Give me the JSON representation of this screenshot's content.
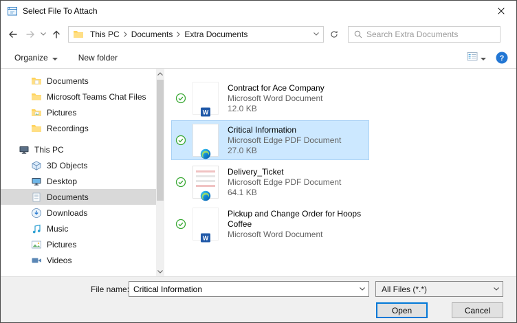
{
  "window": {
    "title": "Select File To Attach"
  },
  "navbar": {
    "breadcrumb": {
      "segments": [
        "This PC",
        "Documents",
        "Extra Documents"
      ]
    },
    "search_placeholder": "Search Extra Documents"
  },
  "toolbar": {
    "organize": "Organize",
    "new_folder": "New folder"
  },
  "sidebar": {
    "items": [
      {
        "label": "Documents"
      },
      {
        "label": "Microsoft Teams Chat Files"
      },
      {
        "label": "Pictures"
      },
      {
        "label": "Recordings"
      },
      {
        "label": "This PC"
      },
      {
        "label": "3D Objects"
      },
      {
        "label": "Desktop"
      },
      {
        "label": "Documents"
      },
      {
        "label": "Downloads"
      },
      {
        "label": "Music"
      },
      {
        "label": "Pictures"
      },
      {
        "label": "Videos"
      }
    ]
  },
  "files": [
    {
      "name": "Contract for Ace Company",
      "type": "Microsoft Word Document",
      "size": "12.0 KB"
    },
    {
      "name": "Critical Information",
      "type": "Microsoft Edge PDF Document",
      "size": "27.0 KB"
    },
    {
      "name": "Delivery_Ticket",
      "type": "Microsoft Edge PDF Document",
      "size": "64.1 KB"
    },
    {
      "name": "Pickup and Change Order for Hoops Coffee",
      "type": "Microsoft Word Document",
      "size": ""
    }
  ],
  "footer": {
    "file_name_label": "File name:",
    "file_name_value": "Critical Information",
    "file_type_value": "All Files (*.*)",
    "open": "Open",
    "cancel": "Cancel"
  },
  "colors": {
    "accent": "#0078d7",
    "selection": "#cce8ff",
    "sync_ok": "#3aa935"
  }
}
